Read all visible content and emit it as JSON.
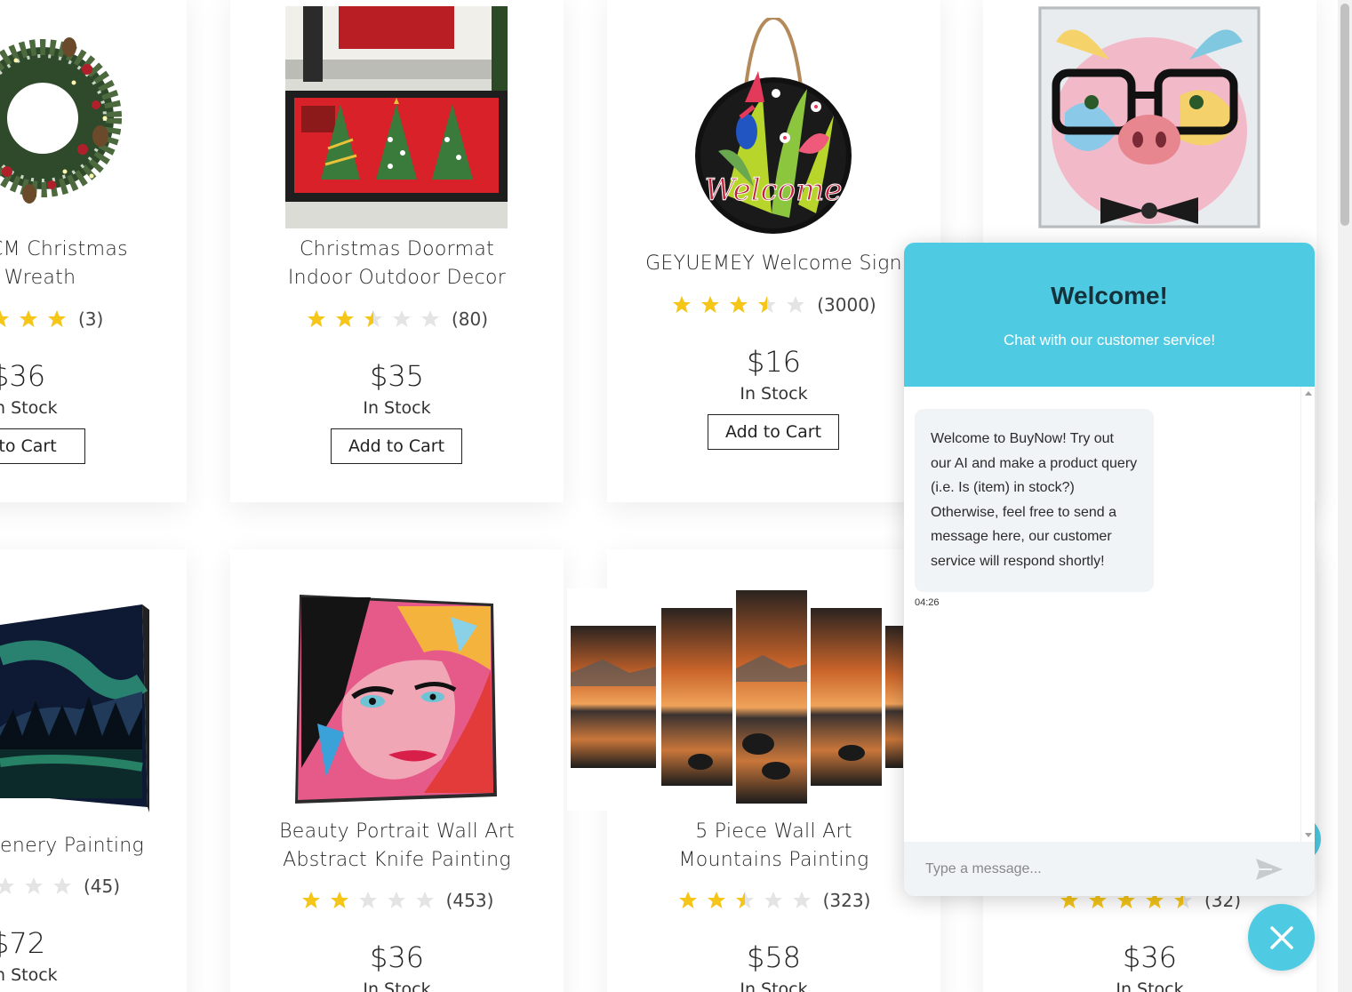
{
  "products": [
    {
      "id": "wreath",
      "title_lines": [
        "CM Christmas",
        "r Wreath"
      ],
      "review_count": "(3)",
      "rating": 5,
      "price": "$36",
      "stock": "n Stock",
      "cart_label": "d to Cart"
    },
    {
      "id": "doormat",
      "title_lines": [
        "Christmas Doormat",
        "Indoor Outdoor Decor"
      ],
      "review_count": "(80)",
      "rating": 2.5,
      "price": "$35",
      "stock": "In Stock",
      "cart_label": "Add to Cart"
    },
    {
      "id": "welcome-sign",
      "title_lines": [
        "GEYUEMEY Welcome Sign"
      ],
      "review_count": "(3000)",
      "rating": 3.5,
      "price": "$16",
      "stock": "In Stock",
      "cart_label": "Add to Cart"
    },
    {
      "id": "pig",
      "title_lines": [],
      "review_count": "",
      "rating": 0,
      "price": "",
      "stock": "",
      "cart_label": ""
    },
    {
      "id": "aurora",
      "title_lines": [
        "enery Painting"
      ],
      "review_count": "(45)",
      "rating": 0,
      "price": "$72",
      "stock": "n Stock",
      "cart_label": ""
    },
    {
      "id": "portrait",
      "title_lines": [
        "Beauty Portrait Wall Art",
        "Abstract Knife Painting"
      ],
      "review_count": "(453)",
      "rating": 2,
      "price": "$36",
      "stock": "In Stock",
      "cart_label": ""
    },
    {
      "id": "mountains",
      "title_lines": [
        "5 Piece Wall Art",
        "Mountains Painting"
      ],
      "review_count": "(323)",
      "rating": 2.5,
      "price": "$58",
      "stock": "In Stock",
      "cart_label": ""
    },
    {
      "id": "pig-bottom",
      "title_lines": [],
      "review_count": "(32)",
      "rating": 4.5,
      "price": "$36",
      "stock": "In Stock",
      "cart_label": ""
    }
  ],
  "chat": {
    "title": "Welcome!",
    "subtitle": "Chat with our customer service!",
    "message": "Welcome to BuyNow! Try out our AI and make a product query (i.e. Is (item) in stock?) Otherwise, feel free to send a message here, our customer service will respond shortly!",
    "time": "04:26",
    "input_placeholder": "Type a message...",
    "input_value": ""
  },
  "colors": {
    "accent": "#4ecbe2",
    "star": "#f5c518",
    "star_empty": "#e4e4e4"
  },
  "icons": {
    "send": "send-icon",
    "close": "close-icon",
    "star": "star-icon"
  }
}
